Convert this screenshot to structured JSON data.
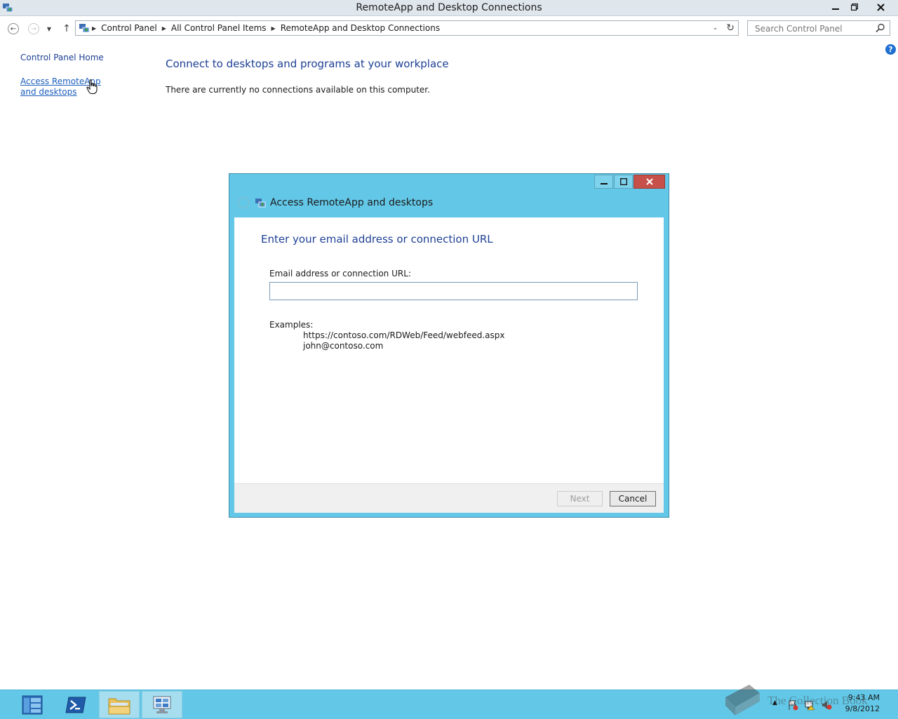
{
  "window": {
    "title": "RemoteApp and Desktop Connections",
    "controls": {
      "minimize": "minimize",
      "restore": "restore",
      "close": "close"
    }
  },
  "nav": {
    "breadcrumbs": [
      "Control Panel",
      "All Control Panel Items",
      "RemoteApp and Desktop Connections"
    ],
    "search_placeholder": "Search Control Panel"
  },
  "left_pane": {
    "home_link": "Control Panel Home",
    "access_link": "Access RemoteApp and desktops"
  },
  "main": {
    "heading": "Connect to desktops and programs at your workplace",
    "message": "There are currently no connections available on this computer."
  },
  "dialog": {
    "title": "Access RemoteApp and desktops",
    "heading": "Enter your email address or connection URL",
    "field_label": "Email address or connection URL:",
    "field_value": "",
    "examples_label": "Examples:",
    "examples": [
      "https://contoso.com/RDWeb/Feed/webfeed.aspx",
      "john@contoso.com"
    ],
    "next_label": "Next",
    "cancel_label": "Cancel"
  },
  "taskbar": {
    "apps": [
      "server-manager-icon",
      "powershell-icon",
      "file-explorer-icon",
      "control-panel-icon"
    ],
    "time": "9:43 AM",
    "date": "9/8/2012"
  },
  "watermark": {
    "text": "The Collection Book"
  },
  "colors": {
    "accent": "#63c8e8",
    "link": "#1c5fbd",
    "heading": "#1c3f94",
    "close": "#c7504a"
  }
}
